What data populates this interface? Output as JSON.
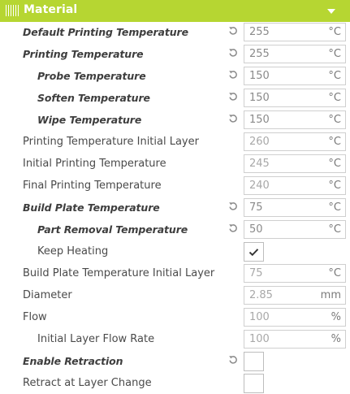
{
  "header": {
    "title": "Material",
    "icon": "material-spool-icon",
    "accent": "#b6d632"
  },
  "rows": [
    {
      "label": "Default Printing Temperature",
      "value": "255",
      "unit": "°C",
      "bold": true,
      "indent": 0,
      "reset": true
    },
    {
      "label": "Printing Temperature",
      "value": "255",
      "unit": "°C",
      "bold": true,
      "indent": 0,
      "reset": true
    },
    {
      "label": "Probe Temperature",
      "value": "150",
      "unit": "°C",
      "bold": true,
      "indent": 1,
      "reset": true
    },
    {
      "label": "Soften Temperature",
      "value": "150",
      "unit": "°C",
      "bold": true,
      "indent": 1,
      "reset": true
    },
    {
      "label": "Wipe Temperature",
      "value": "150",
      "unit": "°C",
      "bold": true,
      "indent": 1,
      "reset": true
    },
    {
      "label": "Printing Temperature Initial Layer",
      "value": "260",
      "unit": "°C",
      "bold": false,
      "indent": 0,
      "reset": false
    },
    {
      "label": "Initial Printing Temperature",
      "value": "245",
      "unit": "°C",
      "bold": false,
      "indent": 0,
      "reset": false
    },
    {
      "label": "Final Printing Temperature",
      "value": "240",
      "unit": "°C",
      "bold": false,
      "indent": 0,
      "reset": false
    },
    {
      "label": "Build Plate Temperature",
      "value": "75",
      "unit": "°C",
      "bold": true,
      "indent": 0,
      "reset": true
    },
    {
      "label": "Part Removal Temperature",
      "value": "50",
      "unit": "°C",
      "bold": true,
      "indent": 1,
      "reset": true
    },
    {
      "label": "Keep Heating",
      "type": "checkbox",
      "checked": true,
      "bold": false,
      "indent": 1,
      "reset": false
    },
    {
      "label": "Build Plate Temperature Initial Layer",
      "value": "75",
      "unit": "°C",
      "bold": false,
      "indent": 0,
      "reset": false
    },
    {
      "label": "Diameter",
      "value": "2.85",
      "unit": "mm",
      "bold": false,
      "indent": 0,
      "reset": false
    },
    {
      "label": "Flow",
      "value": "100",
      "unit": "%",
      "bold": false,
      "indent": 0,
      "reset": false
    },
    {
      "label": "Initial Layer Flow Rate",
      "value": "100",
      "unit": "%",
      "bold": false,
      "indent": 1,
      "reset": false
    },
    {
      "label": "Enable Retraction",
      "type": "checkbox",
      "checked": false,
      "bold": true,
      "indent": 0,
      "reset": true
    },
    {
      "label": "Retract at Layer Change",
      "type": "checkbox",
      "checked": false,
      "bold": false,
      "indent": 0,
      "reset": false
    }
  ]
}
